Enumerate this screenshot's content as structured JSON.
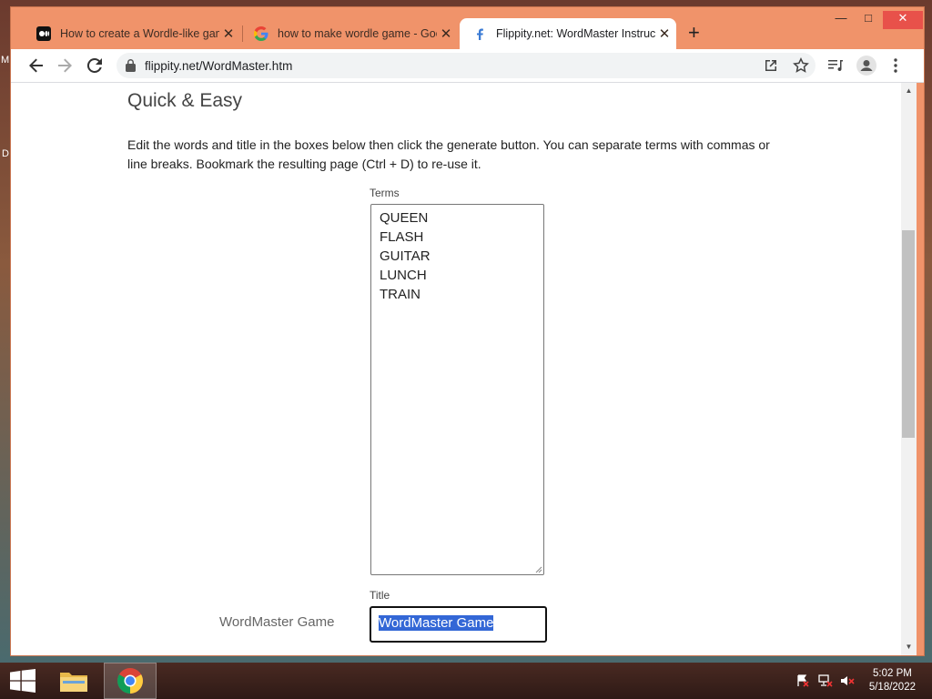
{
  "desktop": {
    "edge_labels": [
      "M",
      "D"
    ]
  },
  "browser": {
    "tabs": [
      {
        "title": "How to create a Wordle-like game",
        "favicon": "medium-icon"
      },
      {
        "title": "how to make wordle game - Google Search",
        "favicon": "google-g-icon"
      },
      {
        "title": "Flippity.net: WordMaster Instructions",
        "favicon": "flippity-f-icon"
      }
    ],
    "address": "flippity.net/WordMaster.htm",
    "window_controls": {
      "minimize": "—",
      "maximize": "□",
      "close": "✕"
    }
  },
  "page": {
    "heading": "Quick & Easy",
    "description": "Edit the words and title in the boxes below then click the generate button. You can separate terms with commas or line breaks. Bookmark the resulting page (Ctrl + D) to re-use it.",
    "terms_label": "Terms",
    "terms": [
      "QUEEN",
      "FLASH",
      "GUITAR",
      "LUNCH",
      "TRAIN"
    ],
    "title_label": "Title",
    "title_preview": "WordMaster Game",
    "title_value": "WordMaster Game"
  },
  "taskbar": {
    "time": "5:02 PM",
    "date": "5/18/2022"
  },
  "colors": {
    "chrome_frame": "#f0936a",
    "selection": "#3367d6"
  }
}
